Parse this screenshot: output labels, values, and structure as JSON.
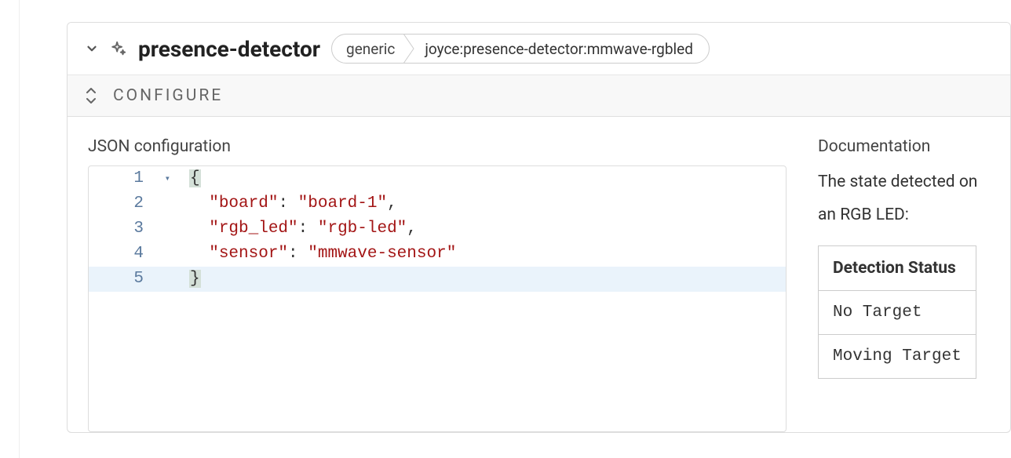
{
  "header": {
    "title": "presence-detector",
    "crumb1": "generic",
    "crumb2": "joyce:presence-detector:mmwave-rgbled"
  },
  "configure": {
    "label": "Configure"
  },
  "json": {
    "label": "JSON configuration",
    "lines": {
      "l1": "{",
      "l2_k": "\"board\"",
      "l2_v": "\"board-1\"",
      "l3_k": "\"rgb_led\"",
      "l3_v": "\"rgb-led\"",
      "l4_k": "\"sensor\"",
      "l4_v": "\"mmwave-sensor\"",
      "l5": "}"
    },
    "line_numbers": {
      "n1": "1",
      "n2": "2",
      "n3": "3",
      "n4": "4",
      "n5": "5"
    }
  },
  "documentation": {
    "label": "Documentation",
    "intro": "The state detected on an RGB LED:",
    "table": {
      "header": "Detection Status",
      "row1": "No Target",
      "row2": "Moving Target"
    }
  }
}
